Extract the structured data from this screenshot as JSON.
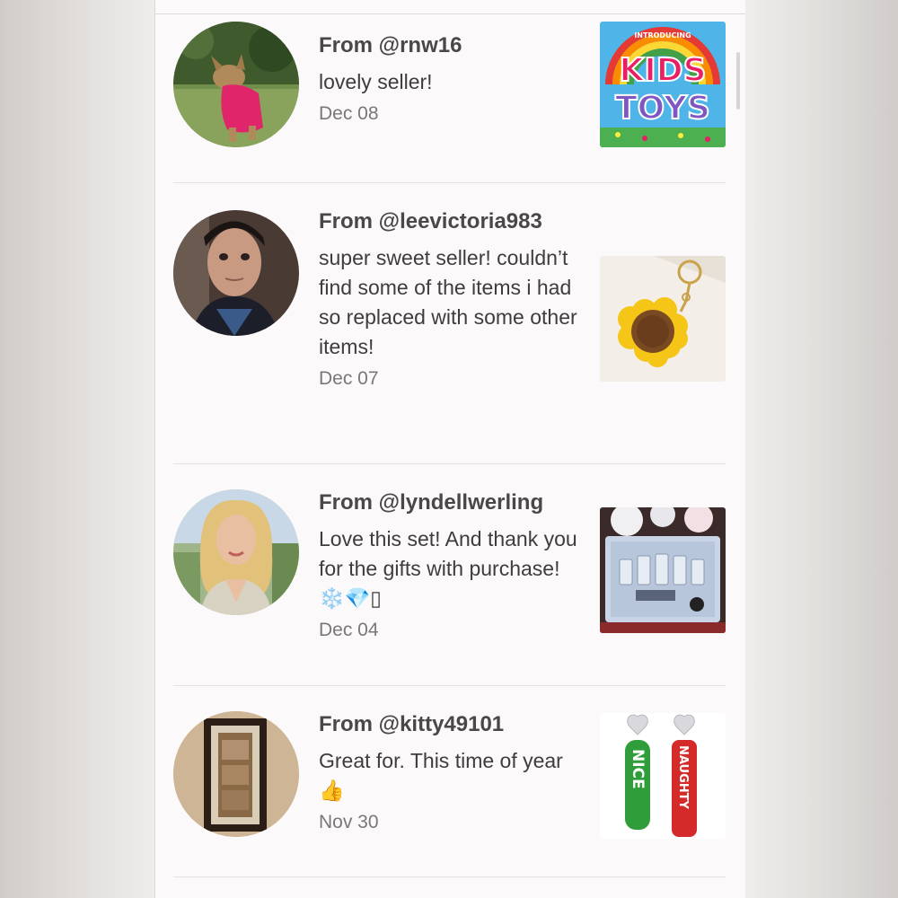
{
  "reviews": [
    {
      "from": "From @rnw16",
      "comment": "lovely seller!",
      "date": "Dec 08",
      "avatar_icon": "dog-in-pink-sweater-photo",
      "thumb_icon": "kids-toys-logo",
      "thumb_text": {
        "top": "INTRODUCING",
        "line1": "KIDS",
        "line2": "TOYS"
      }
    },
    {
      "from": "From @leevictoria983",
      "comment": "super sweet seller! couldn’t find some of the items i had so replaced with some other items!",
      "date": "Dec 07",
      "avatar_icon": "person-selfie-photo",
      "thumb_icon": "sunflower-keychain-photo"
    },
    {
      "from": "From @lyndellwerling",
      "comment": "Love this set! And thank you for the gifts with purchase! ❄️💎▯",
      "date": "Dec 04",
      "avatar_icon": "blonde-woman-portrait-photo",
      "thumb_icon": "glitter-gift-set-photo"
    },
    {
      "from": "From @kitty49101",
      "comment": "Great for. This time of year 👍",
      "date": "Nov 30",
      "avatar_icon": "framed-picture-photo",
      "thumb_icon": "nice-naughty-earrings-photo",
      "thumb_text": {
        "left": "NICE",
        "right": "NAUGHTY"
      }
    }
  ],
  "colors": {
    "panel_bg": "#fbf9fa",
    "username_text": "#4a4748",
    "comment_text": "#3f3c3d",
    "date_text": "#7a7778",
    "divider": "#e4e2e3"
  }
}
